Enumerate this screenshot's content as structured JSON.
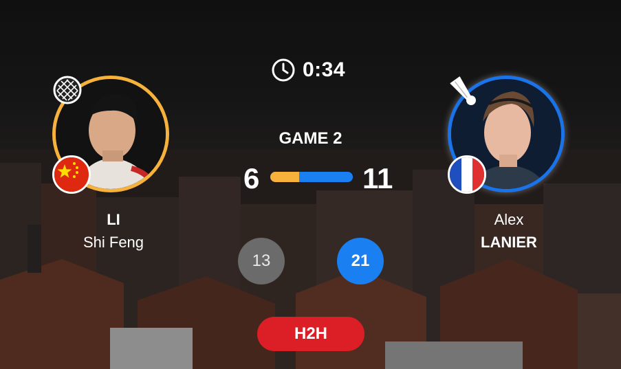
{
  "match": {
    "timer": "0:34",
    "game_label": "GAME 2",
    "score_left": "6",
    "score_right": "11",
    "points_share_left": 0.35,
    "total_left": "13",
    "total_right": "21",
    "h2h_label": "H2H"
  },
  "player_left": {
    "last_name": "LI",
    "first_name": "Shi Feng",
    "flag": "china-flag",
    "indicator_icon": "racket-icon",
    "accent_color": "#f7b23b"
  },
  "player_right": {
    "first_name": "Alex",
    "last_name": "LANIER",
    "flag": "france-flag",
    "indicator_icon": "shuttlecock-icon",
    "accent_color": "#1a73e8"
  },
  "colors": {
    "h2h": "#dc1f26",
    "total_left_bg": "#6b6b6b",
    "total_right_bg": "#1a7ff0"
  }
}
